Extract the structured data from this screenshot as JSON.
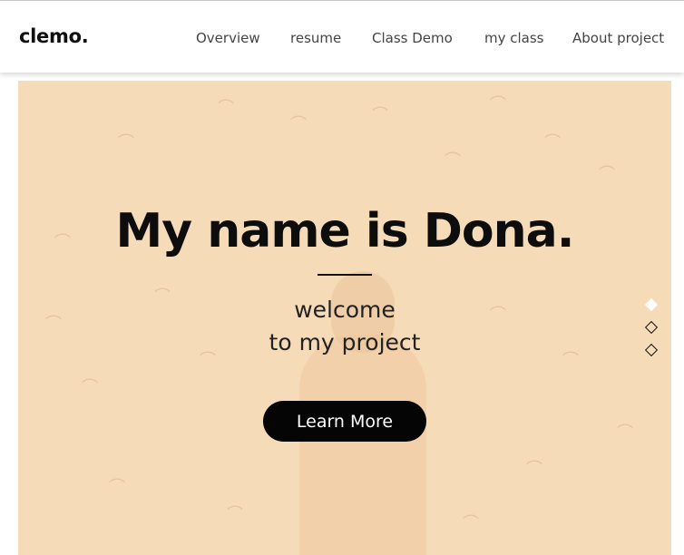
{
  "nav": {
    "brand": "clemo.",
    "links": [
      {
        "label": "Overview"
      },
      {
        "label": "resume"
      },
      {
        "label": "Class Demo"
      },
      {
        "label": "my class"
      },
      {
        "label": "About project"
      }
    ]
  },
  "hero": {
    "title": "My name is Dona.",
    "subtitle_line1": "welcome",
    "subtitle_line2": "to my project",
    "cta_label": "Learn More",
    "background_color": "#f6dbb9",
    "slide_count": 3,
    "active_slide": 1
  }
}
